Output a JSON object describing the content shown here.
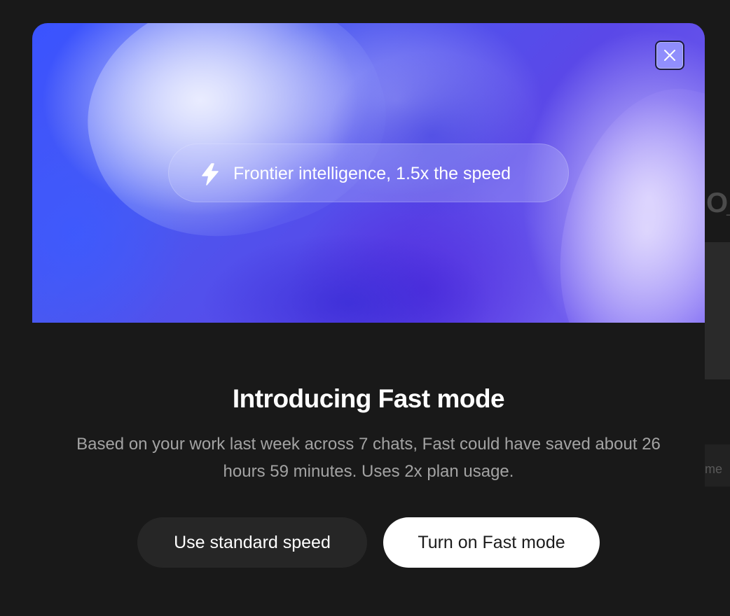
{
  "background_app": {
    "glyph": "O_",
    "row_text": "me"
  },
  "modal": {
    "hero": {
      "close_icon": "close-icon",
      "badge": {
        "icon": "lightning-bolt-icon",
        "text": "Frontier intelligence, 1.5x the speed"
      }
    },
    "title": "Introducing Fast mode",
    "description": "Based on your work last week across 7 chats, Fast could have saved about 26 hours 59 minutes. Uses 2x plan usage.",
    "buttons": {
      "standard_label": "Use standard speed",
      "fast_label": "Turn on Fast mode"
    }
  },
  "colors": {
    "modal_background": "#191919",
    "hero_primary": "#3a53ff",
    "hero_secondary": "#7a66f2",
    "close_button_fill": "#9696ff",
    "standard_button_bg": "#262626",
    "fast_button_bg": "#ffffff",
    "description_text": "#a3a3a3"
  }
}
